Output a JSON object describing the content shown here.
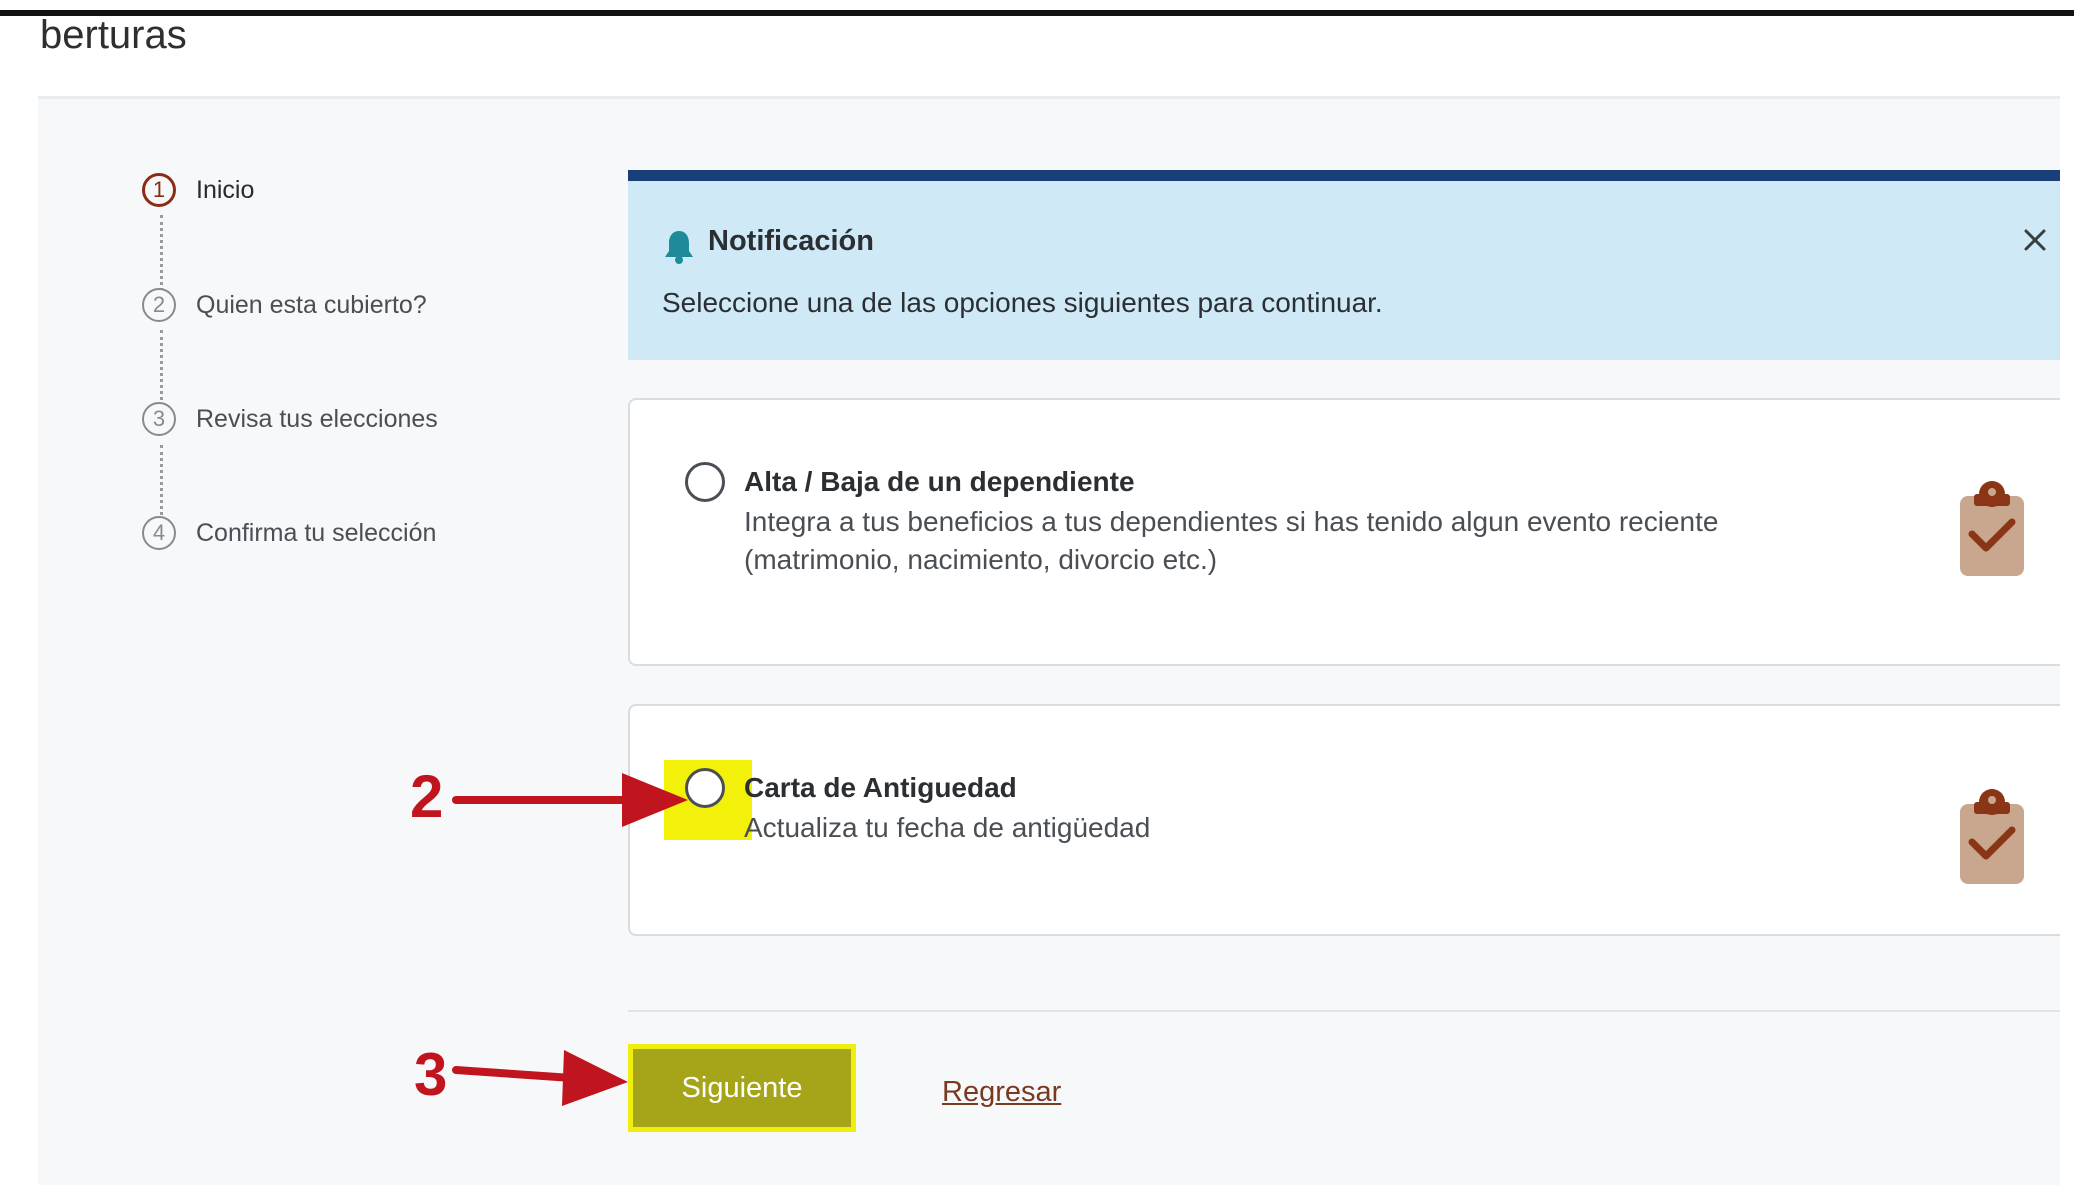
{
  "page": {
    "title": "berturas"
  },
  "stepper": {
    "steps": [
      {
        "number": "1",
        "label": "Inicio"
      },
      {
        "number": "2",
        "label": "Quien esta cubierto?"
      },
      {
        "number": "3",
        "label": "Revisa tus elecciones"
      },
      {
        "number": "4",
        "label": "Confirma tu selección"
      }
    ],
    "active_step": 1
  },
  "notification": {
    "title": "Notificación",
    "message": "Seleccione una de las opciones siguientes para continuar.",
    "icon": "bell-icon",
    "close_icon": "close-icon"
  },
  "options": [
    {
      "title": "Alta / Baja de un dependiente",
      "description_line1": "Integra a tus beneficios a tus dependientes si has tenido algun evento reciente",
      "description_line2": "(matrimonio, nacimiento, divorcio etc.)",
      "selected": false,
      "icon": "clipboard-check-icon"
    },
    {
      "title": "Carta de Antiguedad",
      "description_line1": "Actualiza tu fecha de antigüedad",
      "selected": false,
      "icon": "clipboard-check-icon"
    }
  ],
  "actions": {
    "next_label": "Siguiente",
    "back_label": "Regresar"
  },
  "annotations": {
    "marker_2": "2",
    "marker_3": "3"
  },
  "colors": {
    "brand_navy": "#1a3e77",
    "notification_bg": "#cfe9f6",
    "active_step": "#8b2c15",
    "clipboard": "#c9a78f",
    "next_button": "#a6a51a",
    "highlight": "#f3f10a",
    "annotation_red": "#c0141e"
  }
}
